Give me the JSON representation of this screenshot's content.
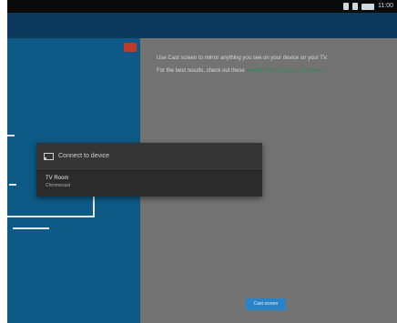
{
  "status_bar": {
    "time": "11:00"
  },
  "promo": {
    "line1": "Use Cast screen to mirror anything you see on your device on your TV.",
    "line2": "For the best results, check out these",
    "link": "recommended apps and devices"
  },
  "dialog": {
    "title": "Connect to device",
    "device_name": "TV Room",
    "device_status": "Chromecast"
  },
  "bottom_button": {
    "label": "Cast screen"
  },
  "colors": {
    "left_pane": "#0d5a86",
    "right_pane": "#737373",
    "accent": "#2a83c6"
  }
}
